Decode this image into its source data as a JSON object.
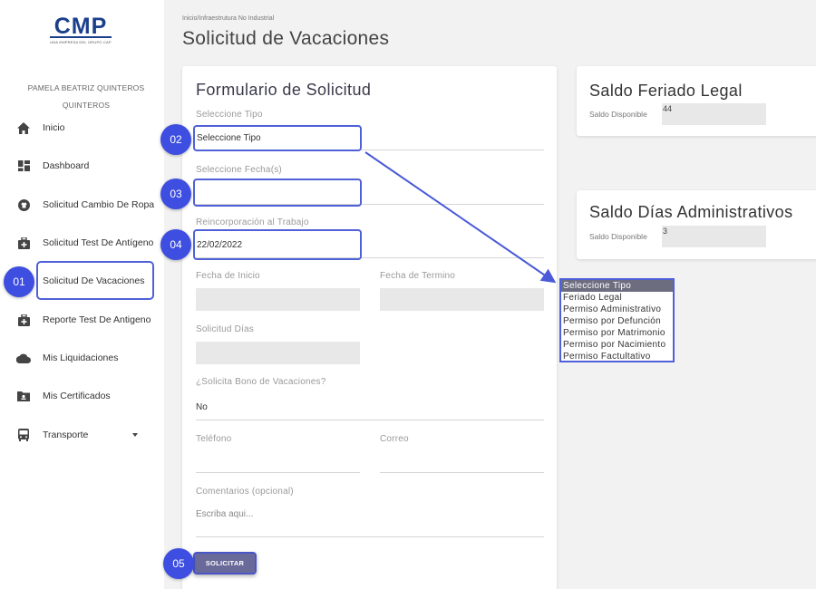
{
  "brand": {
    "logo_text": "CMP",
    "logo_subtitle": "UNA EMPRESA DEL GRUPO CAP"
  },
  "user": {
    "name_line1": "PAMELA BEATRIZ QUINTEROS",
    "name_line2": "QUINTEROS"
  },
  "sidebar": {
    "items": [
      {
        "label": "Inicio",
        "icon": "home-icon"
      },
      {
        "label": "Dashboard",
        "icon": "dashboard-icon"
      },
      {
        "label": "Solicitud Cambio De Ropa",
        "icon": "shirt-icon"
      },
      {
        "label": "Solicitud Test De Antígeno",
        "icon": "medical-kit-icon"
      },
      {
        "label": "Solicitud De Vacaciones",
        "icon": "annotation-badge"
      },
      {
        "label": "Reporte Test De Antigeno",
        "icon": "medical-kit-icon"
      },
      {
        "label": "Mis Liquidaciones",
        "icon": "cloud-icon"
      },
      {
        "label": "Mis Certificados",
        "icon": "certificate-icon"
      },
      {
        "label": "Transporte",
        "icon": "bus-icon"
      }
    ],
    "active_badge": "01"
  },
  "header": {
    "breadcrumb": "Inicio/Infraestrutura No Industrial",
    "title": "Solicitud de Vacaciones"
  },
  "form": {
    "title": "Formulario de Solicitud",
    "tipo": {
      "label": "Seleccione Tipo",
      "value": "Seleccione Tipo",
      "badge": "02"
    },
    "fechas": {
      "label": "Seleccione Fecha(s)",
      "value": "",
      "badge": "03"
    },
    "reincorporacion": {
      "label": "Reincorporación al Trabajo",
      "value": "22/02/2022",
      "badge": "04"
    },
    "fecha_inicio": {
      "label": "Fecha de Inicio"
    },
    "fecha_termino": {
      "label": "Fecha de Termino"
    },
    "solicitud_dias": {
      "label": "Solicitud Días"
    },
    "bono": {
      "label": "¿Solicita Bono de Vacaciones?",
      "value": "No"
    },
    "telefono": {
      "label": "Teléfono"
    },
    "correo": {
      "label": "Correo"
    },
    "comentarios": {
      "label": "Comentarios (opcional)",
      "placeholder": "Escriba aqui..."
    },
    "submit": {
      "label": "SOLICITAR",
      "badge": "05"
    }
  },
  "feriado_card": {
    "title": "Saldo Feriado Legal",
    "label": "Saldo Disponible",
    "value": "44"
  },
  "admin_card": {
    "title": "Saldo Días Administrativos",
    "label": "Saldo Disponible",
    "value": "3"
  },
  "dropdown": {
    "options": [
      "Seleccione Tipo",
      "Feriado Legal",
      "Permiso Administrativo",
      "Permiso por Defunción",
      "Permiso por Matrimonio",
      "Permiso por Nacimiento",
      "Permiso Factultativo"
    ],
    "selected_index": 0
  },
  "colors": {
    "accent": "#3d4ee0",
    "highlight_border": "#5060d8",
    "logo_blue": "#1c3f8c",
    "button": "#6a6a9a"
  }
}
